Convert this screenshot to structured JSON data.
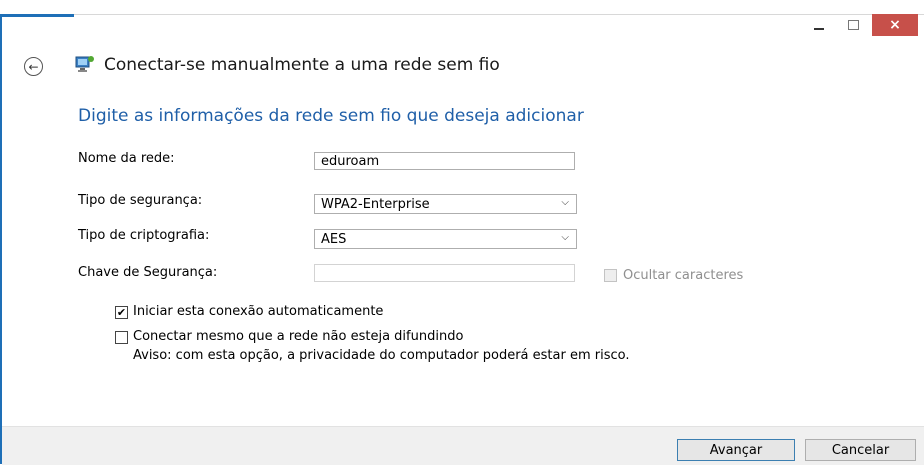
{
  "window": {
    "title": "Conectar-se manualmente a uma rede sem fio",
    "controls": {
      "minimize": "–",
      "maximize": "□",
      "close": "×"
    }
  },
  "back_icon_glyph": "←",
  "heading": "Digite as informações da rede sem fio que deseja adicionar",
  "form": {
    "network_name": {
      "label": "Nome da rede:",
      "value": "eduroam"
    },
    "security_type": {
      "label": "Tipo de segurança:",
      "value": "WPA2-Enterprise"
    },
    "encryption_type": {
      "label": "Tipo de criptografia:",
      "value": "AES"
    },
    "security_key": {
      "label": "Chave de Segurança:",
      "value": ""
    },
    "hide_chars": {
      "label": "Ocultar caracteres",
      "checked": false,
      "enabled": false
    }
  },
  "options": {
    "auto_connect": {
      "label": "Iniciar esta conexão automaticamente",
      "checked": true,
      "mark": "✔"
    },
    "connect_hidden": {
      "label": "Conectar mesmo que a rede não esteja difundindo",
      "checked": false
    },
    "warning": "Aviso: com esta opção, a privacidade do computador poderá estar em risco."
  },
  "buttons": {
    "next": "Avançar",
    "cancel": "Cancelar"
  },
  "icons": {
    "back": "back-arrow-icon",
    "network": "network-computer-icon",
    "chevron": "chevron-down-icon"
  },
  "colors": {
    "accent": "#1e6fb7",
    "heading": "#1f5fa8",
    "close": "#c7504a"
  }
}
